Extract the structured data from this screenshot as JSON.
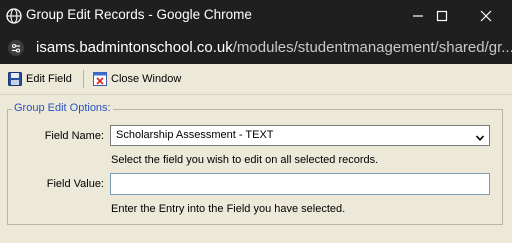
{
  "window": {
    "title": "Group Edit Records - Google Chrome",
    "url_host": "isams.badmintonschool.co.uk",
    "url_path": "/modules/studentmanagement/shared/gr..."
  },
  "toolbar": {
    "edit_field_label": "Edit Field",
    "close_window_label": "Close Window"
  },
  "form": {
    "legend": "Group Edit Options:",
    "field_name_label": "Field Name:",
    "field_name_selected": "Scholarship Assessment - TEXT",
    "field_name_hint": "Select the field you wish to edit on all selected records.",
    "field_value_label": "Field Value:",
    "field_value": "",
    "field_value_hint": "Enter the Entry into the Field you have selected."
  },
  "colors": {
    "titlebar": "#1f1f1f",
    "page_bg": "#ece9d8",
    "legend": "#2a52be"
  }
}
